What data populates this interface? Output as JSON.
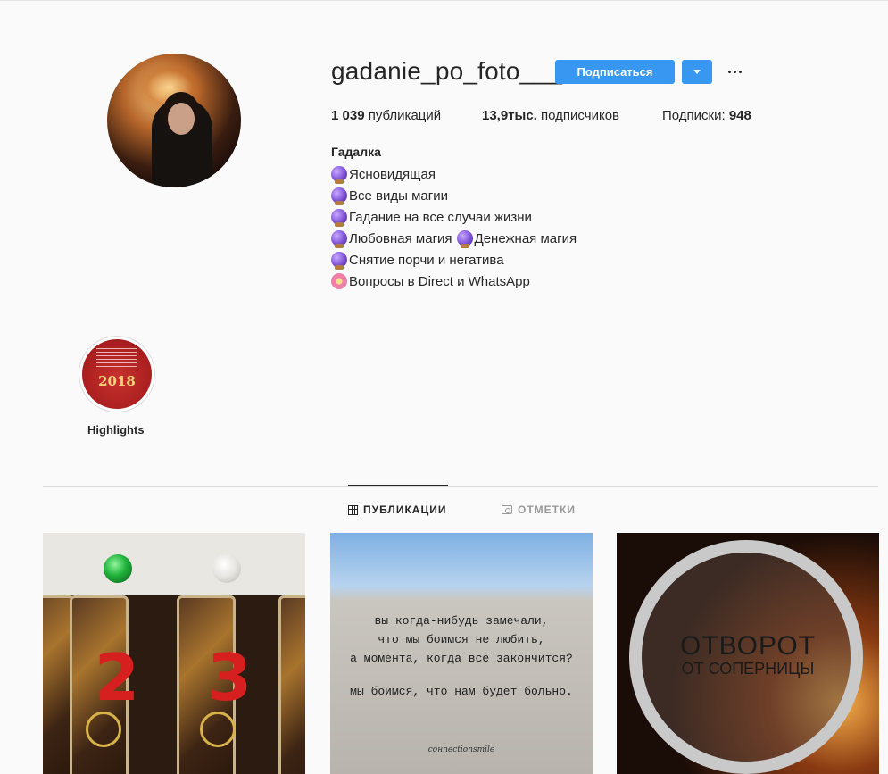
{
  "profile": {
    "username": "gadanie_po_foto___",
    "follow_label": "Подписаться",
    "stats": {
      "posts_value": "1 039",
      "posts_label": "публикаций",
      "followers_value": "13,9тыс.",
      "followers_label": "подписчиков",
      "following_label": "Подписки:",
      "following_value": "948"
    },
    "bio": {
      "name": "Гадалка",
      "lines": [
        {
          "icon": "crystal-ball-icon",
          "text": "Ясновидящая"
        },
        {
          "icon": "crystal-ball-icon",
          "text": "Все виды магии"
        },
        {
          "icon": "crystal-ball-icon",
          "text": "Гадание на все случаи жизни"
        },
        {
          "icon": "crystal-ball-icon",
          "text": "Любовная магия"
        },
        {
          "icon": "crystal-ball-icon",
          "text": "Денежная магия"
        },
        {
          "icon": "crystal-ball-icon",
          "text": "Снятие порчи и негатива"
        },
        {
          "icon": "hibiscus-icon",
          "text": "Вопросы в Direct и WhatsApp"
        }
      ]
    }
  },
  "highlights": [
    {
      "label": "Highlights",
      "cover_text": "2018"
    }
  ],
  "tabs": [
    {
      "label": "ПУБЛИКАЦИИ",
      "icon": "grid-icon",
      "active": true
    },
    {
      "label": "ОТМЕТКИ",
      "icon": "tagged-icon",
      "active": false
    }
  ],
  "posts": [
    {
      "cards": [
        "2",
        "3"
      ]
    },
    {
      "quote_lines": [
        "вы когда-нибудь замечали,",
        "что мы боимся не любить,",
        "а момента, когда все закончится?",
        "мы боимся, что нам будет больно."
      ],
      "signature": "coнnectionsmile"
    },
    {
      "title": "ОТВОРОТ",
      "subtitle": "ОТ СОПЕРНИЦЫ"
    }
  ],
  "colors": {
    "accent": "#3897f0",
    "background": "#fafafa",
    "text": "#262626",
    "muted": "#999999"
  }
}
